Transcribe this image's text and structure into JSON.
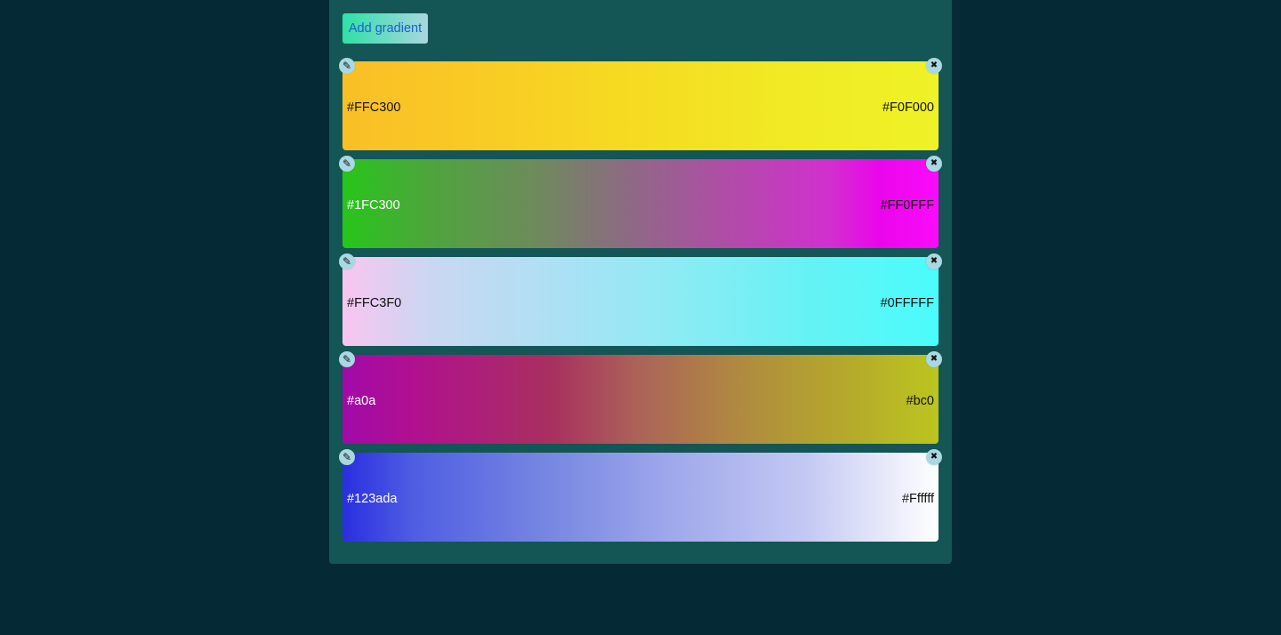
{
  "toolbar": {
    "add_label": "Add gradient"
  },
  "gradients": [
    {
      "start": "#FFC300",
      "end": "#F0F000",
      "start_text_color": "#111111",
      "end_text_color": "#111111",
      "css": "linear-gradient(90deg, #f9bf26 0%, #f9cc24 25%, #f5dc22 50%, #f1ea24 75%, #eff227 100%)"
    },
    {
      "start": "#1FC300",
      "end": "#FF0FFF",
      "start_text_color": "#ffffff",
      "end_text_color": "#111111",
      "css": "linear-gradient(90deg, #27c51b 0%, #4fa43d 15%, #6d8b5b 32%, #8d6a84 48%, #b34aaa 66%, #d22fcf 82%, #ea06ea 90%, #fb0bfb 100%)"
    },
    {
      "start": "#FFC3F0",
      "end": "#0FFFFF",
      "start_text_color": "#111111",
      "end_text_color": "#111111",
      "css": "linear-gradient(90deg, #f9c5f0 0%, #cad7f2 15%, #aee0f4 35%, #8eebf4 55%, #66f2f4 78%, #4afcfc 100%)"
    },
    {
      "start": "#a0a",
      "end": "#bc0",
      "start_text_color": "#ffffff",
      "end_text_color": "#111111",
      "css": "linear-gradient(90deg, #a10aa9 0%, #b1108f 12%, #a8305f 35%, #ac6458 50%, #b08d3e 68%, #b4a82c 84%, #bcc51f 100%)"
    },
    {
      "start": "#123ada",
      "end": "#Ffffff",
      "start_text_color": "#ffffff",
      "end_text_color": "#111111",
      "css": "linear-gradient(90deg, #2a2ee0 0%, #4f5ee2 12%, #7888e2 35%, #9fa8eb 55%, #c4c9f3 78%, #ffffff 100%)"
    }
  ],
  "icons": {
    "edit": "pencil-icon",
    "delete": "close-icon"
  }
}
